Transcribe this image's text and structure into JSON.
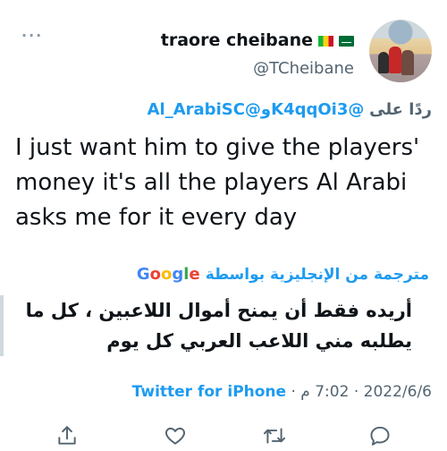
{
  "header": {
    "more_menu": "···",
    "display_name": "traore cheibane",
    "handle": "@TCheibane"
  },
  "reply": {
    "prefix": "ردًا على",
    "mention_1": "@K4qqOi3",
    "and": "و",
    "mention_2": "@Al_ArabiSC"
  },
  "tweet": {
    "text": "I just want him to give the players' money it's all the players Al Arabi asks me for it every day"
  },
  "translation": {
    "label": "مترجمة من الإنجليزية بواسطة",
    "provider": "Google",
    "text": "أريده فقط أن يمنح أموال اللاعبين ، كل ما يطلبه مني اللاعب العربي كل يوم"
  },
  "meta": {
    "date": "2022/6/6",
    "time": "7:02 م",
    "separator": "·",
    "source": "Twitter for iPhone"
  },
  "icons": {
    "share": "share-icon",
    "like": "heart-icon",
    "retweet": "retweet-icon",
    "reply": "reply-icon"
  },
  "colors": {
    "accent": "#1d9bf0",
    "secondary_text": "#536471",
    "primary_text": "#0f1419"
  }
}
